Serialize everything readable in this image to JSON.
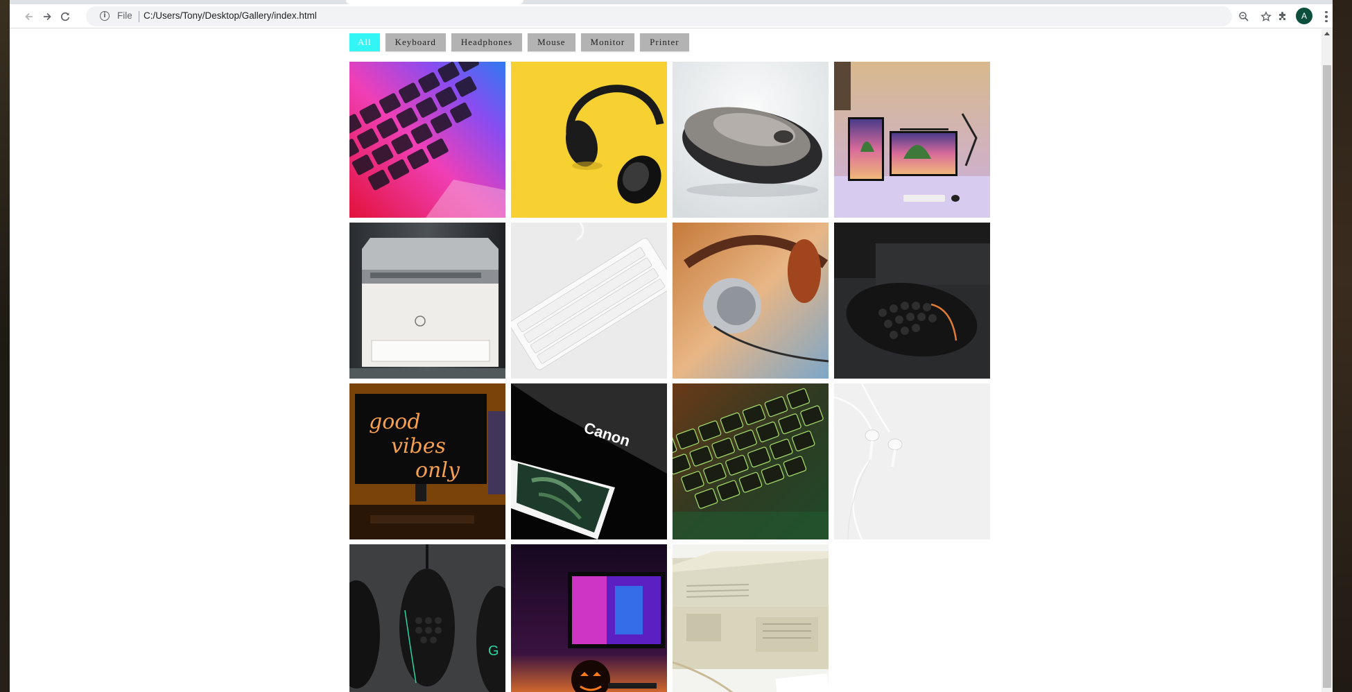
{
  "browser": {
    "url_scheme_label": "File",
    "url": "C:/Users/Tony/Desktop/Gallery/index.html",
    "profile_initial": "A",
    "icons": [
      "back-icon",
      "forward-icon",
      "reload-icon",
      "info-icon",
      "zoom-icon",
      "star-icon",
      "extensions-icon",
      "menu-icon"
    ]
  },
  "filters": {
    "buttons": [
      {
        "label": "All",
        "active": true
      },
      {
        "label": "Keyboard",
        "active": false
      },
      {
        "label": "Headphones",
        "active": false
      },
      {
        "label": "Mouse",
        "active": false
      },
      {
        "label": "Monitor",
        "active": false
      },
      {
        "label": "Printer",
        "active": false
      }
    ],
    "active_color": "#33f5f5",
    "inactive_color": "#b3b3b3"
  },
  "gallery": {
    "images": [
      {
        "category": "keyboard",
        "subject": "pink-blue-backlit-laptop-keyboard"
      },
      {
        "category": "headphones",
        "subject": "black-headphones-on-yellow"
      },
      {
        "category": "mouse",
        "subject": "silver-wireless-mouse"
      },
      {
        "category": "monitor",
        "subject": "dual-monitor-desk-setup"
      },
      {
        "category": "printer",
        "subject": "hp-laser-printer"
      },
      {
        "category": "keyboard",
        "subject": "white-keyboard"
      },
      {
        "category": "headphones",
        "subject": "silver-brown-headphones"
      },
      {
        "category": "mouse",
        "subject": "black-honeycomb-gaming-mouse"
      },
      {
        "category": "monitor",
        "subject": "monitor-with-good-vibes-only-neon",
        "visible_text": "good vibes only"
      },
      {
        "category": "printer",
        "subject": "canon-printer-with-photo",
        "visible_text": "Canon"
      },
      {
        "category": "keyboard",
        "subject": "green-backlit-keyboard"
      },
      {
        "category": "headphones",
        "subject": "white-earbuds"
      },
      {
        "category": "mouse",
        "subject": "three-black-gaming-mice"
      },
      {
        "category": "monitor",
        "subject": "neon-monitor-with-pumpkin"
      },
      {
        "category": "printer",
        "subject": "vintage-beige-printer"
      }
    ]
  }
}
